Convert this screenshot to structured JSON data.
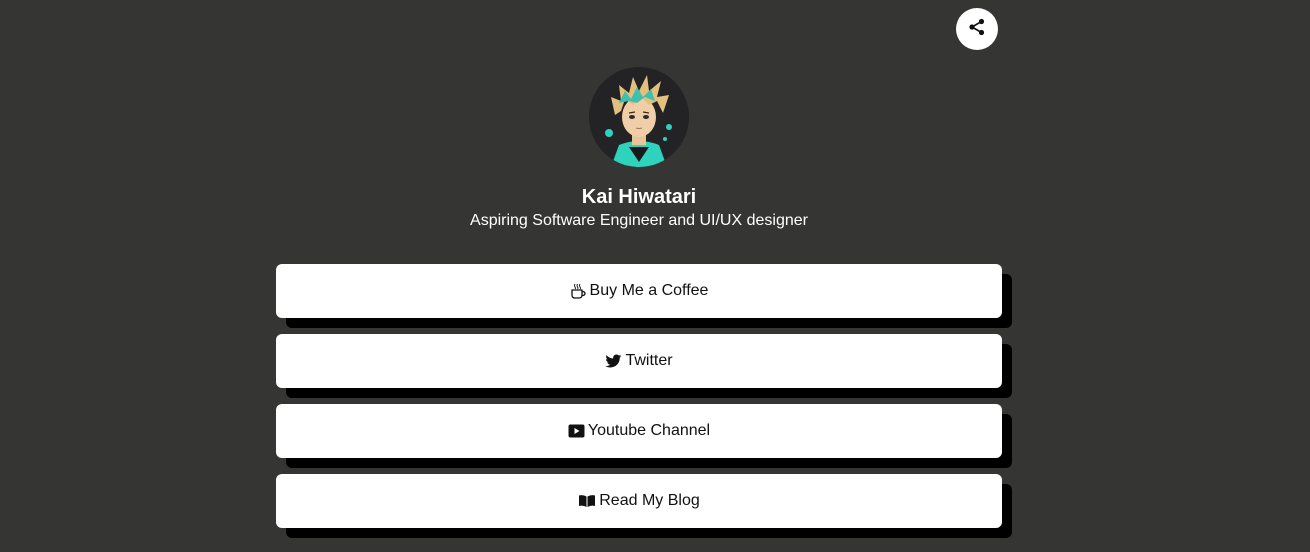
{
  "header": {
    "share_icon": "share-icon"
  },
  "profile": {
    "name": "Kai Hiwatari",
    "bio": "Aspiring Software Engineer and UI/UX designer",
    "avatar": "anime-avatar"
  },
  "links": [
    {
      "label": "Buy Me a Coffee",
      "icon": "coffee-cup-icon"
    },
    {
      "label": "Twitter",
      "icon": "twitter-bird-icon"
    },
    {
      "label": "Youtube Channel",
      "icon": "youtube-icon"
    },
    {
      "label": "Read My Blog",
      "icon": "open-book-icon"
    }
  ],
  "colors": {
    "background": "#353633",
    "button_bg": "#ffffff",
    "button_shadow": "#000000",
    "text_light": "#ffffff",
    "text_dark": "#111111",
    "avatar_accent": "#2fd3bd"
  }
}
